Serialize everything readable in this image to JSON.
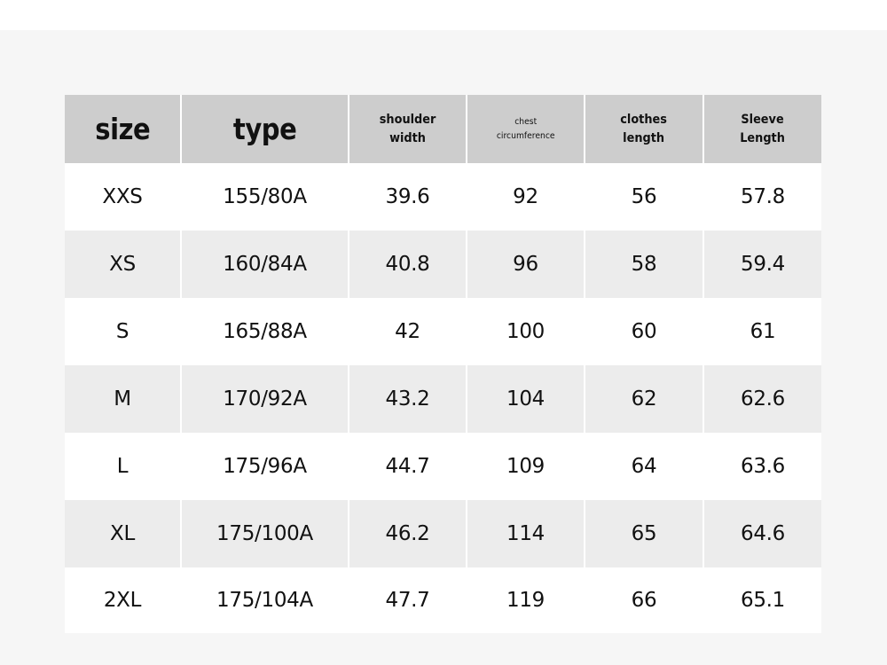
{
  "table": {
    "headers": [
      {
        "key": "size",
        "lines": [
          "size"
        ]
      },
      {
        "key": "type",
        "lines": [
          "type"
        ]
      },
      {
        "key": "shoulder_width",
        "lines": [
          "shoulder",
          "width"
        ]
      },
      {
        "key": "chest_circumference",
        "lines": [
          "chest",
          "circumference"
        ]
      },
      {
        "key": "clothes_length",
        "lines": [
          "clothes",
          "length"
        ]
      },
      {
        "key": "sleeve_length",
        "lines": [
          "Sleeve",
          "Length"
        ]
      }
    ],
    "rows": [
      [
        "XXS",
        "155/80A",
        "39.6",
        "92",
        "56",
        "57.8"
      ],
      [
        "XS",
        "160/84A",
        "40.8",
        "96",
        "58",
        "59.4"
      ],
      [
        "S",
        "165/88A",
        "42",
        "100",
        "60",
        "61"
      ],
      [
        "M",
        "170/92A",
        "43.2",
        "104",
        "62",
        "62.6"
      ],
      [
        "L",
        "175/96A",
        "44.7",
        "109",
        "64",
        "63.6"
      ],
      [
        "XL",
        "175/100A",
        "46.2",
        "114",
        "65",
        "64.6"
      ],
      [
        "2XL",
        "175/104A",
        "47.7",
        "119",
        "66",
        "65.1"
      ]
    ]
  }
}
